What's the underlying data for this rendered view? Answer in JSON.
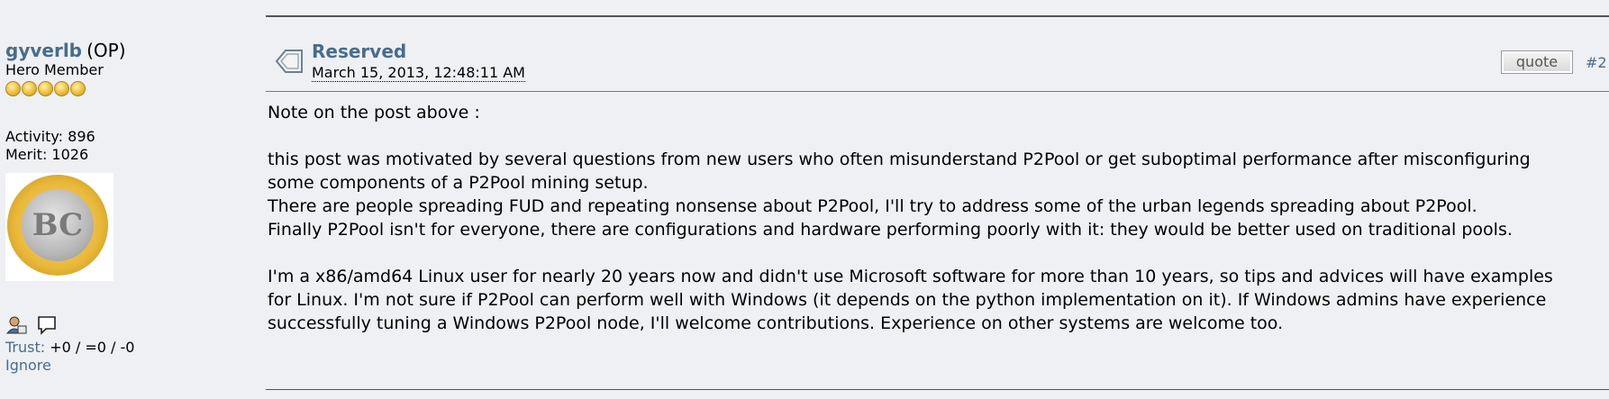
{
  "poster": {
    "name": "gyverlb",
    "op_label": "(OP)",
    "rank": "Hero Member",
    "activity": "Activity: 896",
    "merit": "Merit: 1026",
    "avatar_text": "BC",
    "trust_label": "Trust:",
    "trust_value": "+0 / =0 / -0",
    "ignore_label": "Ignore"
  },
  "post": {
    "subject": "Reserved",
    "date": "March 15, 2013, 12:48:11 AM",
    "quote_label": "quote",
    "number": "#2",
    "lines": {
      "l1": "Note on the post above :",
      "l2": "this post was motivated by several questions from new users who often misunderstand P2Pool or get suboptimal performance after misconfiguring",
      "l3": "some components of a P2Pool mining setup.",
      "l4": "There are people spreading FUD and repeating nonsense about P2Pool, I'll try to address some of the urban legends spreading about P2Pool.",
      "l5": "Finally P2Pool isn't for everyone, there are configurations and hardware performing poorly with it: they would be better used on traditional pools.",
      "l6": "I'm a x86/amd64 Linux user for nearly 20 years now and didn't use Microsoft software for more than 10 years, so tips and advices will have examples",
      "l7": "for Linux. I'm not sure if P2Pool can perform well with Windows (it depends on the python implementation on it). If Windows admins have experience",
      "l8": "successfully tuning a Windows P2Pool node, I'll welcome contributions. Experience on other systems are welcome too."
    }
  },
  "icons": [
    "post-topic-icon",
    "profile-icon",
    "message-icon"
  ],
  "colors": {
    "link": "#476c8e",
    "background": "#eef0f3"
  }
}
